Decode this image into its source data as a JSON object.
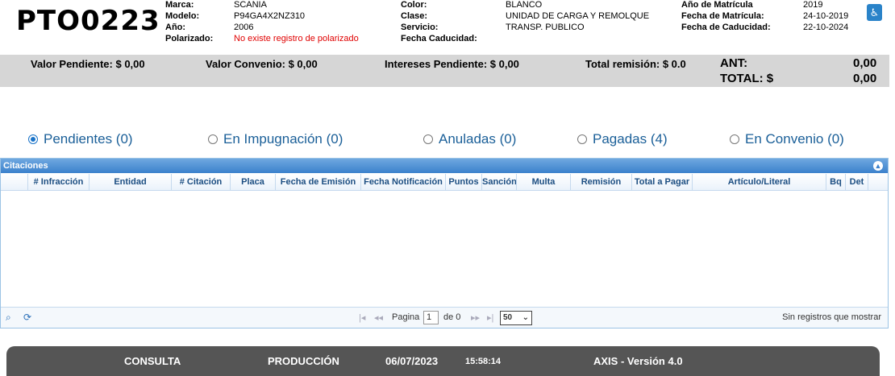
{
  "vehicle": {
    "plate": "PTO0223",
    "col1": [
      {
        "label": "Marca:",
        "value": "SCANIA"
      },
      {
        "label": "Modelo:",
        "value": "P94GA4X2NZ310"
      },
      {
        "label": "Año:",
        "value": "2006"
      },
      {
        "label": "Polarizado:",
        "value": "No existe registro de polarizado"
      }
    ],
    "col2": [
      {
        "label": "Color:",
        "value": "BLANCO"
      },
      {
        "label": "Clase:",
        "value": "UNIDAD DE CARGA Y REMOLQUE"
      },
      {
        "label": "Servicio:",
        "value": "TRANSP. PUBLICO"
      },
      {
        "label": "Fecha Caducidad:",
        "value": ""
      }
    ],
    "col3": [
      {
        "label": "Año de Matrícula",
        "value": "2019"
      },
      {
        "label": "Fecha de Matrícula:",
        "value": "24-10-2019"
      },
      {
        "label": "Fecha de Caducidad:",
        "value": "22-10-2024"
      }
    ],
    "accessibility_icon": "wheelchair-icon",
    "accent_color": "#2a83c9",
    "alert_color": "#e00000"
  },
  "totals": {
    "pendiente": "Valor Pendiente: $  0,00",
    "convenio": "Valor Convenio: $  0,00",
    "intereses": "Intereses Pendiente: $  0,00",
    "remision": "Total remisión: $ 0.0",
    "ant_label": "ANT:",
    "ant_value": "0,00",
    "total_label": "TOTAL: $",
    "total_value": "0,00"
  },
  "filters": [
    {
      "label": "Pendientes (0)",
      "selected": true
    },
    {
      "label": "En Impugnación (0)",
      "selected": false
    },
    {
      "label": "Anuladas (0)",
      "selected": false
    },
    {
      "label": "Pagadas (4)",
      "selected": false
    },
    {
      "label": "En Convenio (0)",
      "selected": false
    }
  ],
  "grid": {
    "title": "Citaciones",
    "columns": [
      "# Infracción",
      "Entidad",
      "# Citación",
      "Placa",
      "Fecha de Emisión",
      "Fecha Notificación",
      "Puntos",
      "Sanción",
      "Multa",
      "Remisión",
      "Total a Pagar",
      "Artículo/Literal",
      "Bq",
      "Det"
    ],
    "rows": [],
    "pager": {
      "page_label": "Pagina",
      "page_value": "1",
      "of_label": "de 0",
      "page_size": "50",
      "status": "Sin registros que mostrar"
    }
  },
  "footer": {
    "mode": "CONSULTA",
    "env": "PRODUCCIÓN",
    "date": "06/07/2023",
    "time": "15:58:14",
    "version": "AXIS - Versión 4.0"
  }
}
